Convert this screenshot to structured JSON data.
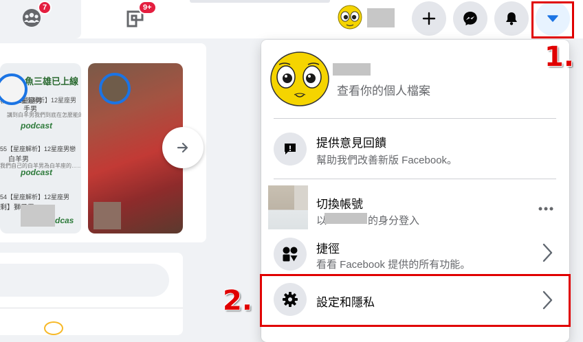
{
  "topbar": {
    "groups_badge": "7",
    "gaming_badge": "9+"
  },
  "step_labels": {
    "step1": "1.",
    "step2": "2."
  },
  "stories": {
    "story1_lines": [
      "魚三雄已上線",
      "析】12星座男",
      "手男",
      "【星座解析】12星座男",
      "講到白羊男我們到底在怎麼能的…",
      "podcast",
      "55【星座解析】12星座男戀",
      "白羊男",
      "我們自己的白羊男為白羊座的……",
      "podcast",
      "54【星座解析】12星座男",
      "剩】獅子男",
      "…",
      "dcas"
    ]
  },
  "menu": {
    "profile_sub": "查看你的個人檔案",
    "feedback_title": "提供意見回饋",
    "feedback_sub": "幫助我們改善新版 Facebook。",
    "switch_title": "切換帳號",
    "switch_sub_prefix": "以",
    "switch_sub_suffix": "的身分登入",
    "shortcuts_title": "捷徑",
    "shortcuts_sub": "看看 Facebook 提供的所有功能。",
    "settings_title": "設定和隱私"
  },
  "colors": {
    "highlight": "#e00000",
    "badge": "#e41e3f",
    "accent": "#1b74e4",
    "secondary_text": "#65676b"
  }
}
